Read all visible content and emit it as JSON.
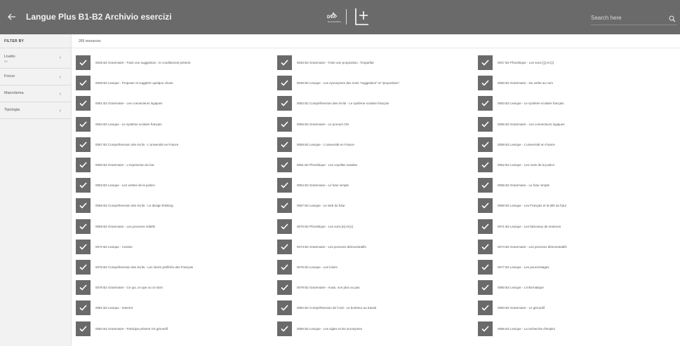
{
  "header": {
    "title": "Langue Plus B1-B2 Archivio esercizi",
    "logo_text": "DVA",
    "logo_sub": "DeA SCUOLA",
    "search_placeholder": "Search here"
  },
  "sidebar": {
    "heading": "FILTER BY",
    "filters": [
      {
        "label": "Livello",
        "sub": "B2"
      },
      {
        "label": "Focus",
        "sub": ""
      },
      {
        "label": "Macrotema",
        "sub": ""
      },
      {
        "label": "Tipologia",
        "sub": ""
      }
    ]
  },
  "main": {
    "count": "265 resources",
    "columns": [
      [
        "0045 B2 Grammaire - Faire une suggestion : le conditionnel présent",
        "0048 B2 Lexique - Proposer et suggérer quelque chose",
        "0051 B2 Grammaire - Les connecteurs logiques",
        "0054 B2 Lexique - Le système scolaire français",
        "0057 B2 Compréhension des écrits - L'université en France",
        "0060 B2 Grammaire - L'expression du but",
        "0063 B2 Lexique - Les verbes de la justice",
        "0066 B2 Compréhension des écrits - Le design thinking",
        "0069 B2 Grammaire - Les pronoms relatifs",
        "0072 B2 Lexique - Cuisine",
        "0075 B2 Compréhension des écrits - Les loisirs préférés des Français",
        "0078 B2 Grammaire - Ce qui, ce que ou ce dont",
        "0081 B2 Lexique - Internet",
        "0084 B2 Grammaire - Participe présent VS gérondif"
      ],
      [
        "0046 B2 Grammaire - Faire une proposition : l'imparfait",
        "0049 B2 Lexique - Les synonymes des mots \"suggestion\" et \"proposition\"",
        "0052 B2 Compréhension des écrits - Le système scolaire français",
        "0055 B2 Grammaire - Le pronom ON",
        "0058 B2 Lexique - L'université en France",
        "0061 B2 Phonétique - Les voyelles nasales",
        "0064 B2 Grammaire - Le futur simple",
        "0067 B2 Lexique - Le web du futur",
        "0070 B2 Phonétique - Les sons [e] et [ɛ]",
        "0073 B2 Grammaire - Les pronoms démonstratifs",
        "0076 B2 Lexique - Les loisirs",
        "0079 B2 Grammaire - Aussi, non plus ou pas",
        "0082 B2 Compréhension de l'oral - Le bonheur au travail",
        "0085 B2 Lexique - Les sigles et les acronymes"
      ],
      [
        "0047 B2 Phonétique - Les sons [ʒ] et [z]",
        "0050 B2 Grammaire - Du verbe au nom",
        "0053 B2 Lexique - Le système scolaire français",
        "0056 B2 Grammaire - Les connecteurs logiques",
        "0059 B2 Lexique - L'université en France",
        "0062 B2 Lexique - Les mots de la justice",
        "0065 B2 Grammaire - Le futur simple",
        "0068 B2 Lexique - Les Français et la télé du futur",
        "0071 B2 Lexique - Les faisceaux de neutrons",
        "0074 B2 Grammaire - Les pronoms démonstratifs",
        "0077 B2 Lexique - Les pourcentages",
        "0080 B2 Lexique - L'informatique",
        "0083 B2 Grammaire - Le gérondif",
        "0086 B2 Lexique - La recherche d'emploi"
      ]
    ]
  }
}
